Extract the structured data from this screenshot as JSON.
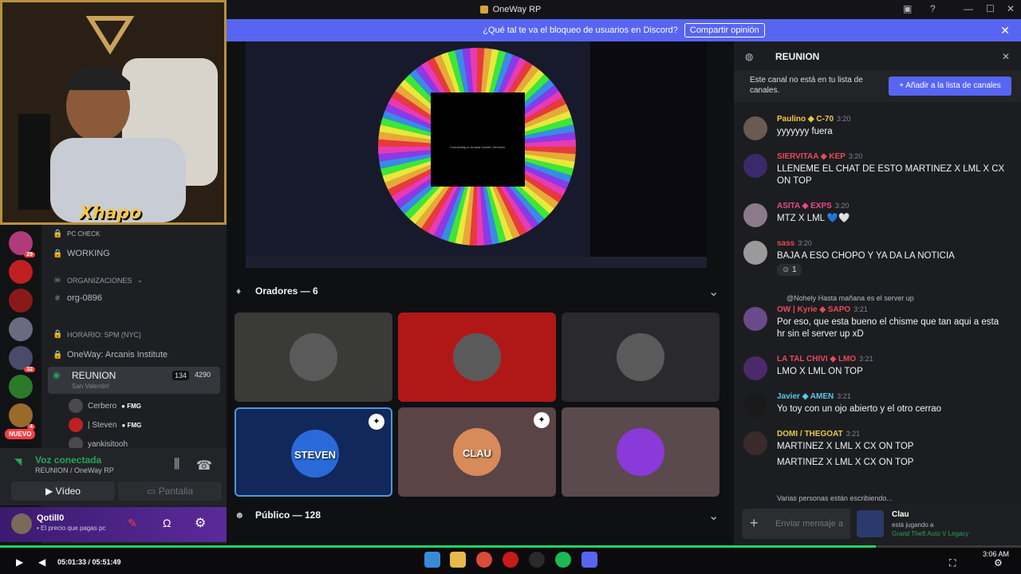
{
  "window": {
    "title": "OneWay RP"
  },
  "notice": {
    "text": "¿Qué tal te va el bloqueo de usuarios en Discord?",
    "button": "Compartir opinión"
  },
  "webcam": {
    "overlay_name": "Xhapo"
  },
  "channels": {
    "pc_check": "PC CHECK",
    "working": "WORKING",
    "category_orgs": "ORGANIZACIONES",
    "org": "org-0896",
    "horario": "HORARIO: 5PM (NYC)",
    "institute": "OneWay: Arcanis Institute",
    "reunion": {
      "label": "REUNION",
      "count_video": "134",
      "count_users": "4290",
      "subtitle": "San Valentin!"
    },
    "voice_users": [
      {
        "name": "Cerbero",
        "tag": "FMG"
      },
      {
        "name": "| Steven",
        "tag": "FMG"
      },
      {
        "name": "yankisitooh"
      }
    ]
  },
  "servers": [
    {
      "badge": "29",
      "color": "#b03a7a"
    },
    {
      "badge": "",
      "color": "#c02020"
    },
    {
      "badge": "",
      "color": "#8a1a1a"
    },
    {
      "badge": "",
      "color": "#6a6a80"
    },
    {
      "badge": "32",
      "color": "#4a4a6a"
    },
    {
      "badge": "",
      "color": "#2a7a2a"
    },
    {
      "badge": "4",
      "color": "#9a6a2a"
    }
  ],
  "new_badge": "NUEVO",
  "voice": {
    "status": "Voz conectada",
    "channel": "REUNION",
    "server": "OneWay RP",
    "video_button": "Vídeo",
    "screen_button": "Pantalla"
  },
  "user": {
    "name": "Qotill0",
    "status": "• El precio que pagas pc"
  },
  "stage": {
    "speakers_label": "Oradores — 6",
    "public_label": "Público — 128",
    "shared_screen_caption": "Connecting to Arcana Games Services",
    "tiles": [
      {
        "label": "",
        "bg": "#3a3a36"
      },
      {
        "label": "",
        "bg": "#b01818"
      },
      {
        "label": "",
        "bg": "#2a2a2e"
      },
      {
        "label": "STEVEN",
        "bg": "#12285a"
      },
      {
        "label": "CLAU",
        "bg": "#5a4446"
      },
      {
        "label": "",
        "bg": "#5a4a4e"
      }
    ]
  },
  "chat": {
    "channel_name": "REUNION",
    "notice": "Este canal no está en tu lista de canales.",
    "add_button": "Añadir a la lista de canales",
    "messages": [
      {
        "name": "Paulino",
        "tag": "C-70",
        "time": "3:20",
        "text": "yyyyyyy fuera",
        "color": "#f2c744",
        "avatar": "#6a5a50"
      },
      {
        "name": "SIERVITAA",
        "tag": "KEP",
        "time": "3:20",
        "text": "LLENEME EL CHAT DE ESTO MARTINEZ X LML X CX ON TOP",
        "color": "#e84a5a",
        "avatar": "#3a2a6a"
      },
      {
        "name": "ASITA",
        "tag": "EXPS",
        "time": "3:20",
        "text": "MTZ X LML 💙🤍",
        "color": "#e84a8a",
        "avatar": "#8a7a8a"
      },
      {
        "name": "sass",
        "tag": "",
        "time": "3:20",
        "text": "BAJA A ESO CHOPO Y YA DA LA NOTICIA",
        "color": "#e84a5a",
        "avatar": "#9a9a9a",
        "reaction": "1"
      },
      {
        "name": "OW | Kyrie",
        "tag": "SAPO",
        "time": "3:21",
        "reply": "@Nohely Hasta mañana es el server up",
        "text": "Por eso, que esta bueno el chisme que tan aqui a esta hr sin el server up xD",
        "color": "#e84a5a",
        "avatar": "#6a4a8a"
      },
      {
        "name": "LA TAL CHIVI",
        "tag": "LMO",
        "time": "3:21",
        "text": "LMO X LML ON TOP",
        "color": "#e84a5a",
        "avatar": "#4a2a6a"
      },
      {
        "name": "Javier",
        "tag": "AMEN",
        "time": "3:21",
        "text": "Yo toy con un ojo abierto y el otro cerrao",
        "color": "#5ac8e8",
        "avatar": "#1a1a1a"
      },
      {
        "name": "DOMI / THEGOAT",
        "tag": "",
        "time": "3:21",
        "text": "MARTINEZ X LML X CX ON TOP",
        "text2": "MARTINEZ X LML X CX ON TOP",
        "color": "#e8c84a",
        "avatar": "#3a2a2a"
      }
    ],
    "typing": "Varias personas están escribiendo...",
    "input_placeholder": "Enviar mensaje a"
  },
  "toast": {
    "name": "Clau",
    "line1": "está jugando a",
    "line2": "Grand Theft Auto V Legacy"
  },
  "player": {
    "time": "05:01:33 / 05:51:49",
    "progress": 0.858
  },
  "clock": {
    "time": "3:06 AM"
  },
  "icons": [
    "play-icon",
    "volume-icon",
    "fullscreen-icon",
    "close-icon",
    "mic-icon",
    "headphones-icon",
    "gear-icon",
    "lock-icon",
    "speaker-icon",
    "chevron-down-icon",
    "plus-icon",
    "windows-icon"
  ]
}
